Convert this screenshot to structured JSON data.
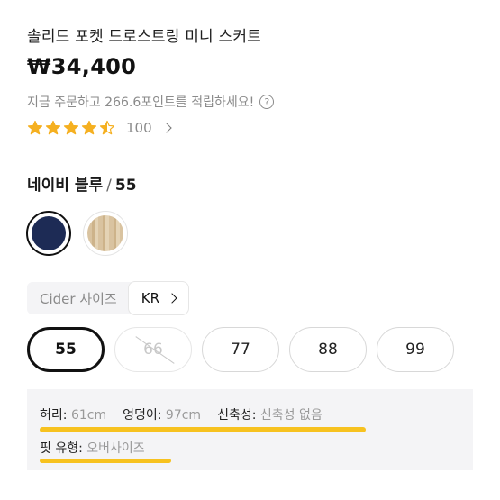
{
  "product": {
    "title": "솔리드 포켓 드로스트링 미니 스커트",
    "price": "₩34,400",
    "points_text": "지금 주문하고 266.6포인트를 적립하세요!",
    "rating": 4.5,
    "rating_max": 5,
    "review_count": "100"
  },
  "variant": {
    "color_name": "네이비 블루",
    "separator": "/",
    "size_name": "55",
    "swatches": [
      {
        "name": "navy",
        "color": "#1d2b55",
        "selected": true
      },
      {
        "name": "beige",
        "color": "#d9c3a0",
        "selected": false
      }
    ]
  },
  "size_chart": {
    "label": "Cider 사이즈",
    "region": "KR"
  },
  "sizes": [
    {
      "label": "55",
      "state": "selected"
    },
    {
      "label": "66",
      "state": "disabled"
    },
    {
      "label": "77",
      "state": "normal"
    },
    {
      "label": "88",
      "state": "normal"
    },
    {
      "label": "99",
      "state": "normal"
    }
  ],
  "fit_info": {
    "waist_key": "허리:",
    "waist_val": "61cm",
    "hip_key": "엉덩이:",
    "hip_val": "97cm",
    "stretch_key": "신축성:",
    "stretch_val": "신축성 없음",
    "fit_type_key": "핏 유형:",
    "fit_type_val": "오버사이즈"
  },
  "colors": {
    "star": "#f5b021",
    "highlight": "#f7c21f"
  }
}
